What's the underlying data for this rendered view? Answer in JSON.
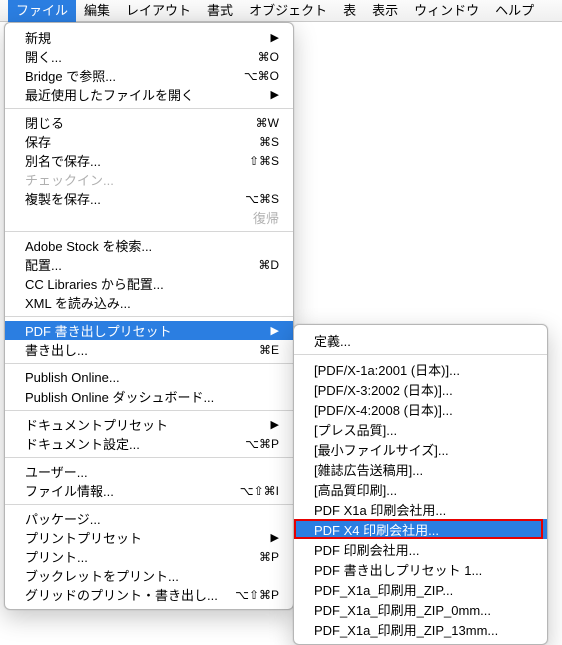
{
  "menubar": [
    "ファイル",
    "編集",
    "レイアウト",
    "書式",
    "オブジェクト",
    "表",
    "表示",
    "ウィンドウ",
    "ヘルプ"
  ],
  "menubar_active": 0,
  "dropdown": {
    "groups": [
      [
        {
          "lbl": "新規",
          "arrow": true
        },
        {
          "lbl": "開く...",
          "sc": "⌘O"
        },
        {
          "lbl": "Bridge で参照...",
          "sc": "⌥⌘O"
        },
        {
          "lbl": "最近使用したファイルを開く",
          "arrow": true
        }
      ],
      [
        {
          "lbl": "閉じる",
          "sc": "⌘W"
        },
        {
          "lbl": "保存",
          "sc": "⌘S"
        },
        {
          "lbl": "別名で保存...",
          "sc": "⇧⌘S"
        },
        {
          "lbl": "チェックイン...",
          "disabled": true
        },
        {
          "lbl": "複製を保存...",
          "sc": "⌥⌘S"
        },
        {
          "lbl": "復帰",
          "disabled": true,
          "right": true
        }
      ],
      [
        {
          "lbl": "Adobe Stock を検索..."
        },
        {
          "lbl": "配置...",
          "sc": "⌘D"
        },
        {
          "lbl": "CC Libraries から配置..."
        },
        {
          "lbl": "XML を読み込み..."
        }
      ],
      [
        {
          "lbl": "PDF 書き出しプリセット",
          "arrow": true,
          "selected": true
        },
        {
          "lbl": "書き出し...",
          "sc": "⌘E"
        }
      ],
      [
        {
          "lbl": "Publish Online..."
        },
        {
          "lbl": "Publish Online ダッシュボード..."
        }
      ],
      [
        {
          "lbl": "ドキュメントプリセット",
          "arrow": true
        },
        {
          "lbl": "ドキュメント設定...",
          "sc": "⌥⌘P"
        }
      ],
      [
        {
          "lbl": "ユーザー..."
        },
        {
          "lbl": "ファイル情報...",
          "sc": "⌥⇧⌘I"
        }
      ],
      [
        {
          "lbl": "パッケージ..."
        },
        {
          "lbl": "プリントプリセット",
          "arrow": true
        },
        {
          "lbl": "プリント...",
          "sc": "⌘P"
        },
        {
          "lbl": "ブックレットをプリント..."
        },
        {
          "lbl": "グリッドのプリント・書き出し...",
          "sc": "⌥⇧⌘P"
        }
      ]
    ]
  },
  "submenu": {
    "header": [
      {
        "lbl": "定義..."
      }
    ],
    "items": [
      {
        "lbl": "[PDF/X-1a:2001 (日本)]..."
      },
      {
        "lbl": "[PDF/X-3:2002 (日本)]..."
      },
      {
        "lbl": "[PDF/X-4:2008 (日本)]..."
      },
      {
        "lbl": "[プレス品質]..."
      },
      {
        "lbl": "[最小ファイルサイズ]..."
      },
      {
        "lbl": "[雑誌広告送稿用]..."
      },
      {
        "lbl": "[高品質印刷]..."
      },
      {
        "lbl": "PDF X1a 印刷会社用..."
      },
      {
        "lbl": "PDF X4 印刷会社用...",
        "selected": true,
        "highlight": true
      },
      {
        "lbl": "PDF 印刷会社用..."
      },
      {
        "lbl": "PDF 書き出しプリセット 1..."
      },
      {
        "lbl": "PDF_X1a_印刷用_ZIP..."
      },
      {
        "lbl": "PDF_X1a_印刷用_ZIP_0mm..."
      },
      {
        "lbl": "PDF_X1a_印刷用_ZIP_13mm..."
      }
    ]
  }
}
